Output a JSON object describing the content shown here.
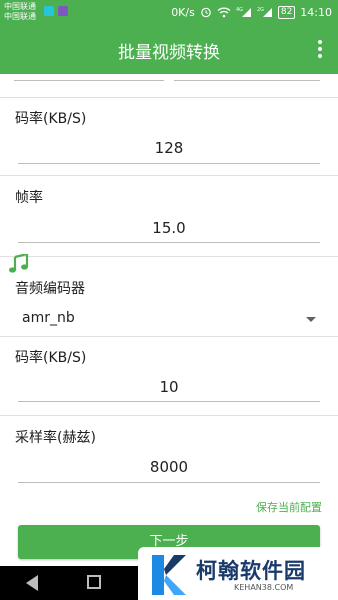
{
  "status_bar": {
    "carrier_line1": "中国联通",
    "carrier_line2": "中国联通",
    "speed": "0K/s",
    "battery": "82",
    "time": "14:10",
    "signal_1_label": "4G",
    "signal_2_label": "2G"
  },
  "app_bar": {
    "title": "批量视频转换"
  },
  "video": {
    "bitrate_label": "码率(KB/S)",
    "bitrate_value": "128",
    "framerate_label": "帧率",
    "framerate_value": "15.0"
  },
  "audio": {
    "section_icon": "music-note-icon",
    "encoder_label": "音频编码器",
    "encoder_value": "amr_nb",
    "bitrate_label": "码率(KB/S)",
    "bitrate_value": "10",
    "samplerate_label": "采样率(赫兹)",
    "samplerate_value": "8000"
  },
  "actions": {
    "save_config": "保存当前配置",
    "next": "下一步"
  },
  "watermark": {
    "name": "柯翰软件园",
    "url": "KEHAN38.COM"
  },
  "colors": {
    "accent": "#4caf50",
    "brand": "#1a3a6b"
  }
}
